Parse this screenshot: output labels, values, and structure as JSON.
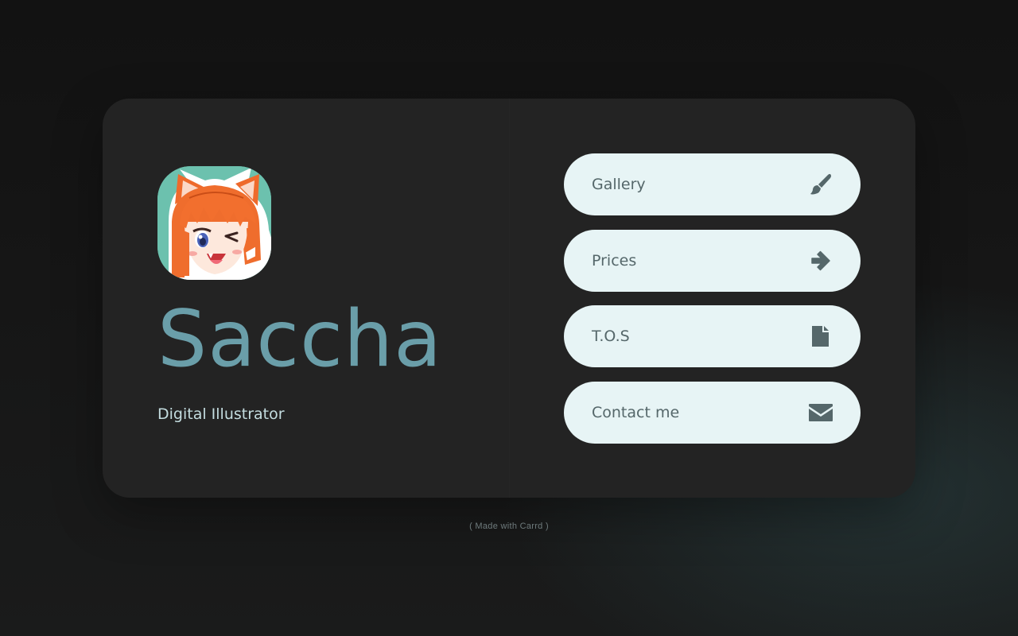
{
  "profile": {
    "name": "Saccha",
    "subtitle": "Digital Illustrator",
    "avatar_icon": "fox-girl-avatar-icon"
  },
  "links": [
    {
      "label": "Gallery",
      "icon": "paintbrush-icon"
    },
    {
      "label": "Prices",
      "icon": "arrow-right-icon"
    },
    {
      "label": "T.O.S",
      "icon": "file-icon"
    },
    {
      "label": "Contact me",
      "icon": "envelope-icon"
    }
  ],
  "footer": {
    "text": "( Made with Carrd )"
  },
  "colors": {
    "accent": "#6a9ea9",
    "button_bg": "#e7f4f5",
    "card_bg": "#232323",
    "icon": "#55676a"
  }
}
